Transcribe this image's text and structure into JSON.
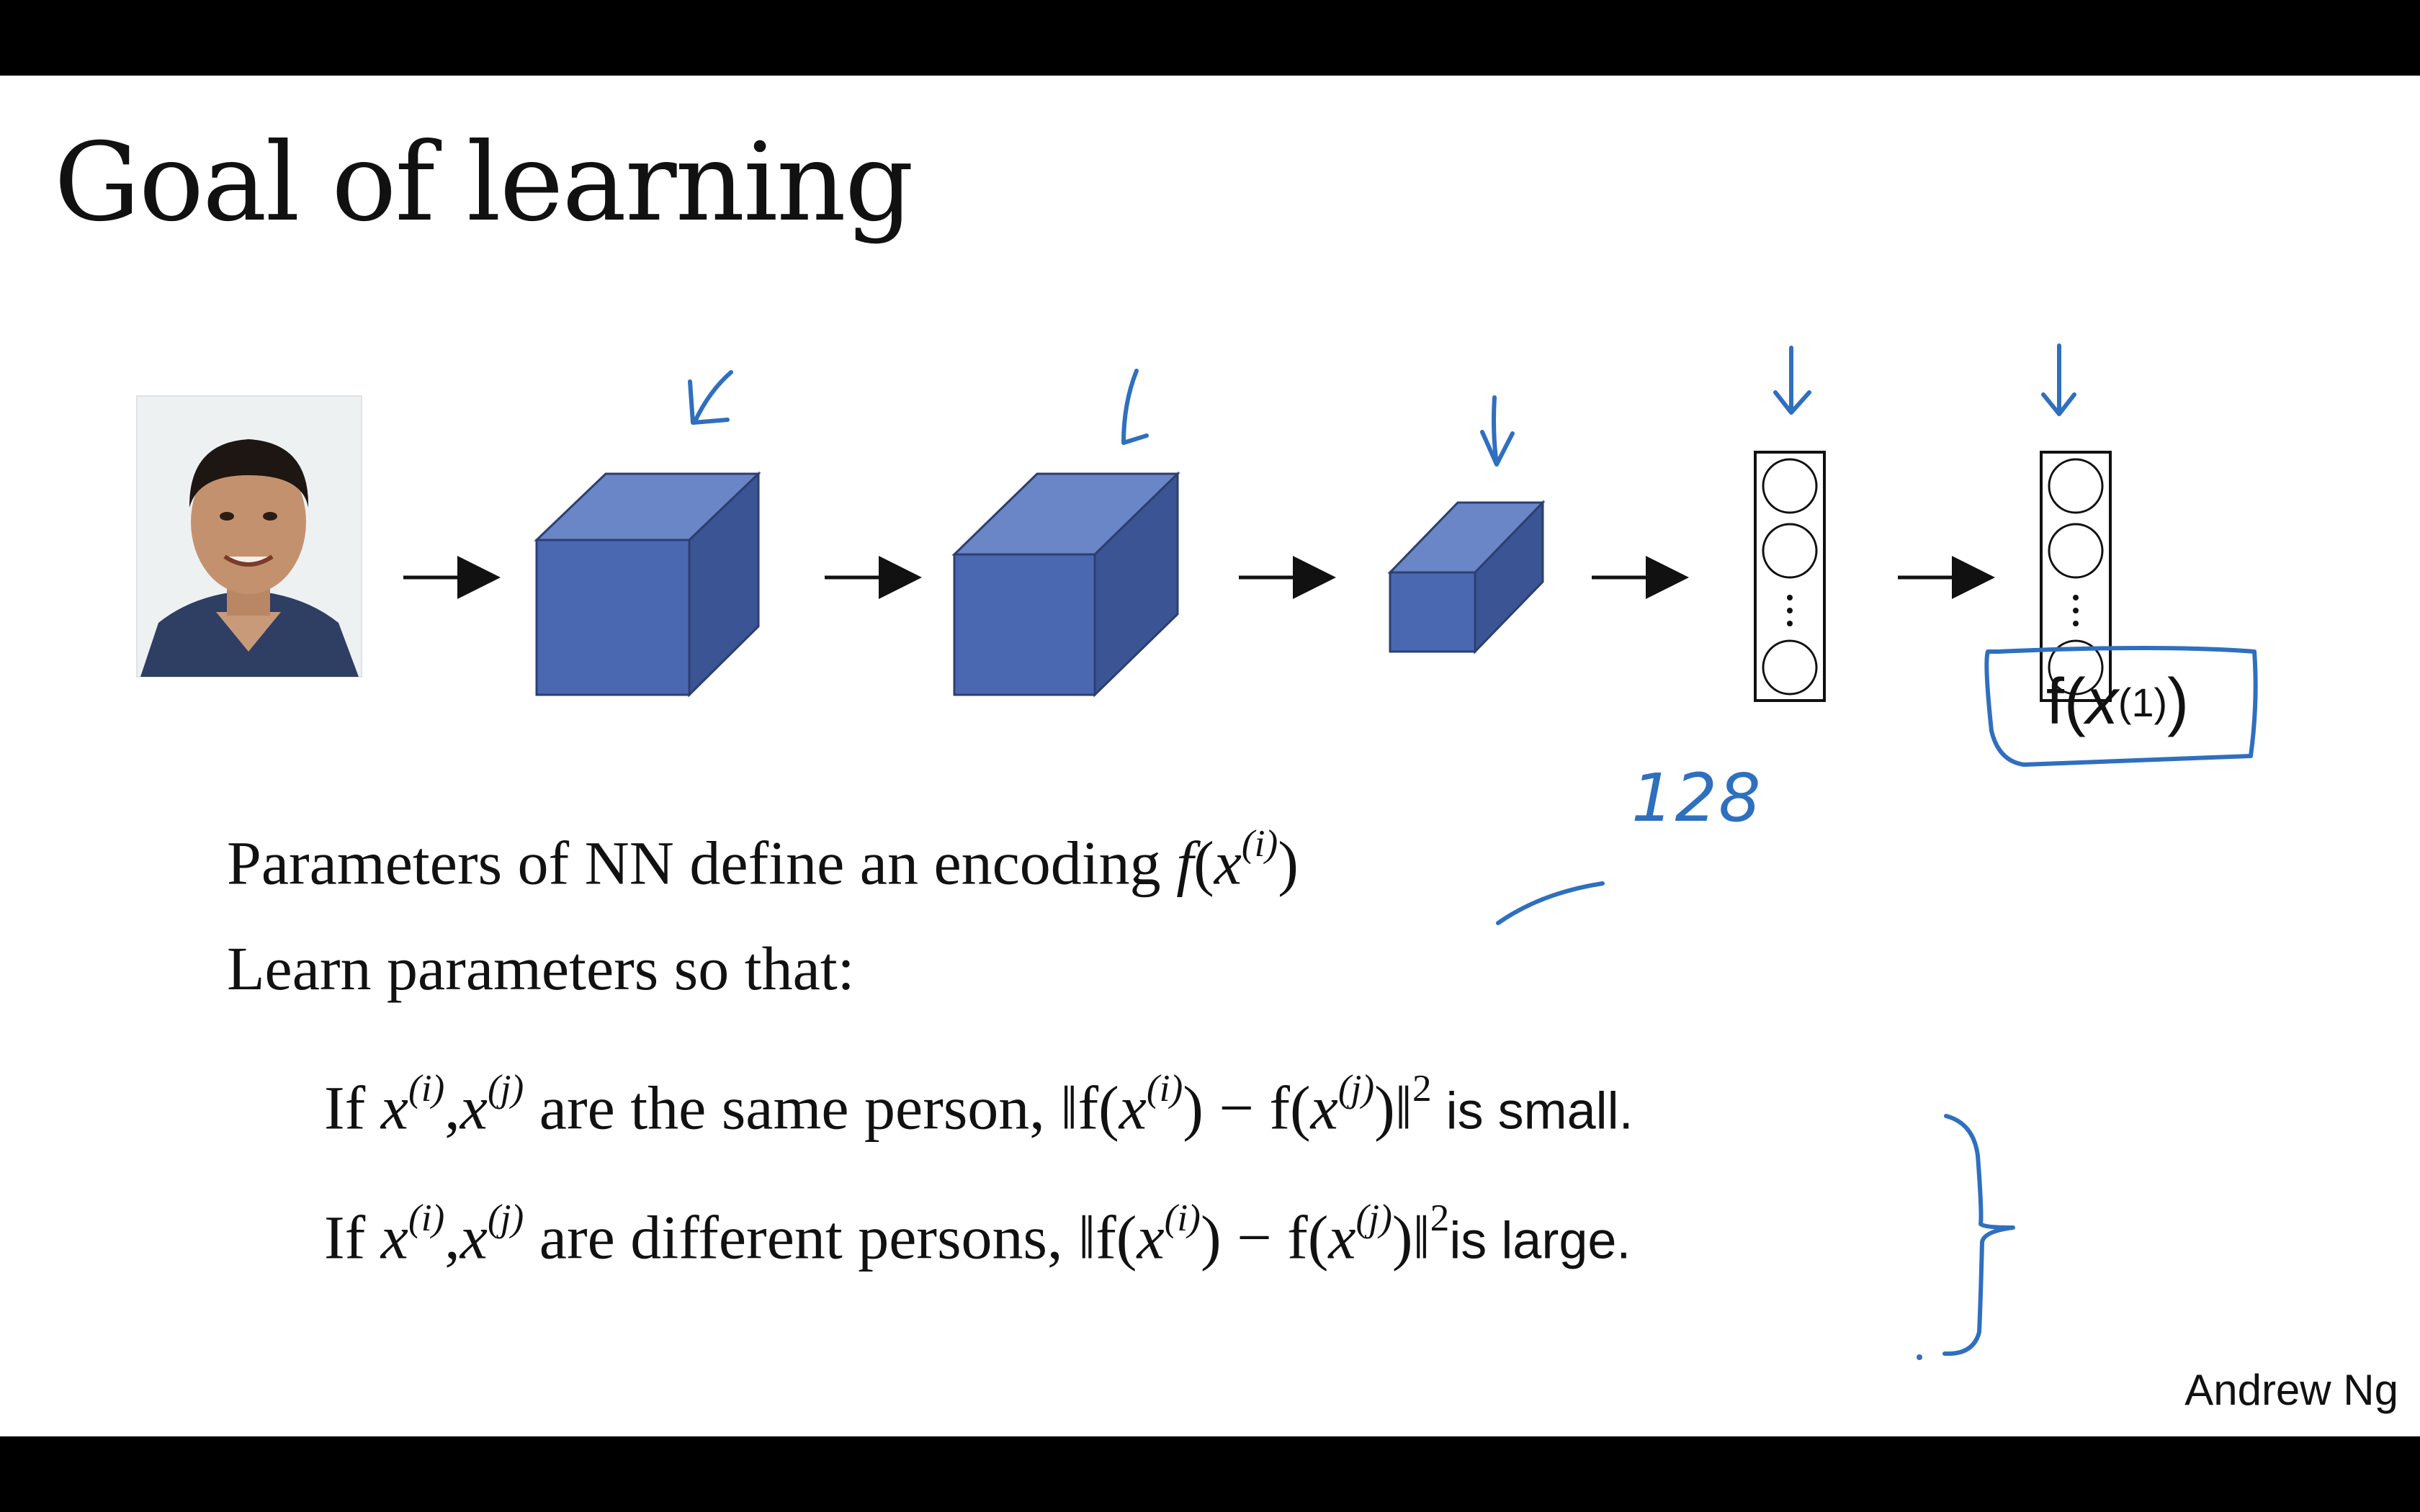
{
  "slide": {
    "title": "Goal of learning",
    "author": "Andrew Ng",
    "encoding_label": {
      "f": "f(",
      "x": "x",
      "sup": "(1)",
      "close": ")"
    },
    "annotation_128": "128",
    "line1": {
      "text": "Parameters of NN define an encoding ",
      "f": "f",
      "open": "(",
      "x": "x",
      "sup": "(i)",
      "close": ")"
    },
    "line2": {
      "text": "Learn parameters so that:"
    },
    "line3": {
      "if": "If ",
      "xi": "x",
      "sup_i": "(i)",
      "comma": ",",
      "xj": "x",
      "sup_j": "(j)",
      "middle": " are the same person, ",
      "norm_open": "‖f(",
      "x1": "x",
      "s1": "(i)",
      "minus": ") − f(",
      "x2": "x",
      "s2": "(j)",
      "norm_close": ")‖",
      "power": "2",
      "tail": " is small."
    },
    "line4": {
      "if": "If ",
      "xi": "x",
      "sup_i": "(i)",
      "comma": ",",
      "xj": "x",
      "sup_j": "(j)",
      "middle": " are different persons, ",
      "norm_open": "‖f(",
      "x1": "x",
      "s1": "(i)",
      "minus": ") − f(",
      "x2": "x",
      "s2": "(j)",
      "norm_close": ")‖",
      "power": "2",
      "tail": "is large."
    },
    "colors": {
      "cube_front": "#4a68b2",
      "cube_top": "#6a86c6",
      "cube_side": "#3a5494",
      "annotation": "#2f6fbf"
    },
    "icons": [
      "face-photo",
      "arrow-right",
      "hand-drawn-arrow",
      "curly-brace"
    ]
  }
}
